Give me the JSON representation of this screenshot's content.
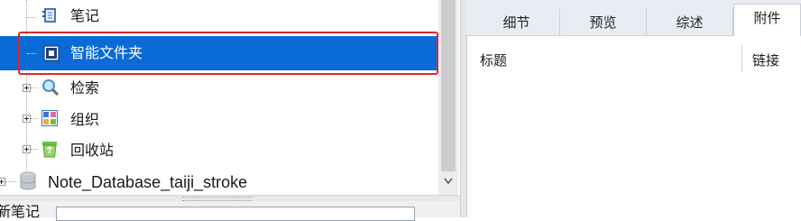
{
  "tree": {
    "items": [
      {
        "label": "笔记",
        "icon": "notebook-icon"
      },
      {
        "label": "智能文件夹",
        "icon": "smart-folder-icon",
        "selected": true
      },
      {
        "label": "检索",
        "icon": "search-icon"
      },
      {
        "label": "组织",
        "icon": "organize-grid-icon"
      },
      {
        "label": "回收站",
        "icon": "recycle-bin-icon"
      },
      {
        "label": "Note_Database_taiji_stroke",
        "icon": "database-icon"
      }
    ]
  },
  "bottom": {
    "label": "新笔记",
    "input_value": ""
  },
  "tabs": [
    {
      "label": "细节"
    },
    {
      "label": "预览"
    },
    {
      "label": "综述"
    },
    {
      "label": "附件",
      "active": true
    }
  ],
  "table": {
    "columns": [
      "标题",
      "链接"
    ]
  },
  "colors": {
    "selection": "#0a6ad6",
    "highlight_border": "#e1262c",
    "panel_bg": "#dfe5ee"
  }
}
